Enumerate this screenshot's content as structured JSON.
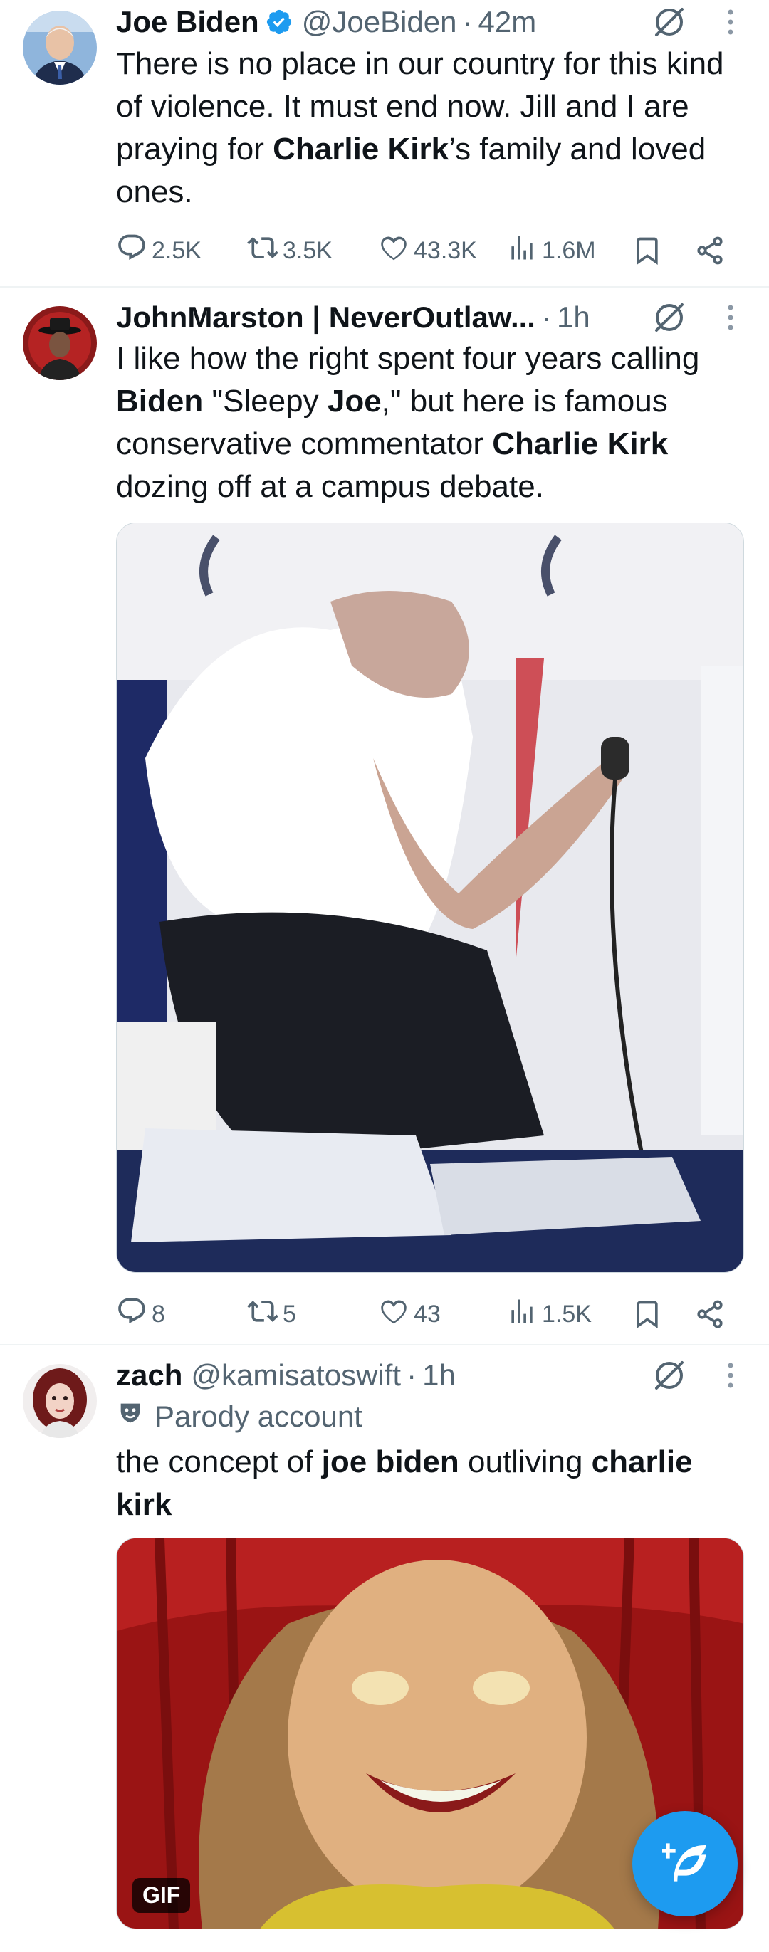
{
  "tweets": [
    {
      "author": "Joe Biden",
      "handle": "@JoeBiden",
      "dot": "·",
      "time": "42m",
      "verified": true,
      "text_parts": [
        "There is no place in our country for this kind of violence. It must end now. Jill and I are praying for ",
        "Charlie Kirk",
        "’s family and loved ones."
      ],
      "actions": {
        "replies": "2.5K",
        "reposts": "3.5K",
        "likes": "43.3K",
        "views": "1.6M"
      }
    },
    {
      "author": "JohnMarston | NeverOutlaw...",
      "dot": "·",
      "time": "1h",
      "text_parts": [
        "I like how the right spent four years calling ",
        "Biden",
        " \"Sleepy ",
        "Joe",
        ",\" but here is famous conservative commentator ",
        "Charlie Kirk",
        " dozing off at a campus debate."
      ],
      "actions": {
        "replies": "8",
        "reposts": "5",
        "likes": "43",
        "views": "1.5K"
      }
    },
    {
      "author": "zach",
      "handle": "@kamisatoswift",
      "dot": "·",
      "time": "1h",
      "parody_label": "Parody account",
      "text_parts": [
        "the concept of ",
        "joe biden",
        " outliving ",
        "charlie kirk"
      ],
      "gif_badge": "GIF"
    }
  ],
  "icons": {
    "verified": "verified-badge-icon",
    "grok": "grok-icon",
    "more": "more-vertical-icon",
    "reply": "reply-icon",
    "repost": "repost-icon",
    "like": "heart-icon",
    "views": "views-icon",
    "bookmark": "bookmark-icon",
    "share": "share-icon",
    "parody": "mask-icon",
    "compose": "compose-icon"
  },
  "colors": {
    "accent": "#1d9bf0",
    "text": "#0f1419",
    "muted": "#536471",
    "divider": "#eff3f4"
  }
}
